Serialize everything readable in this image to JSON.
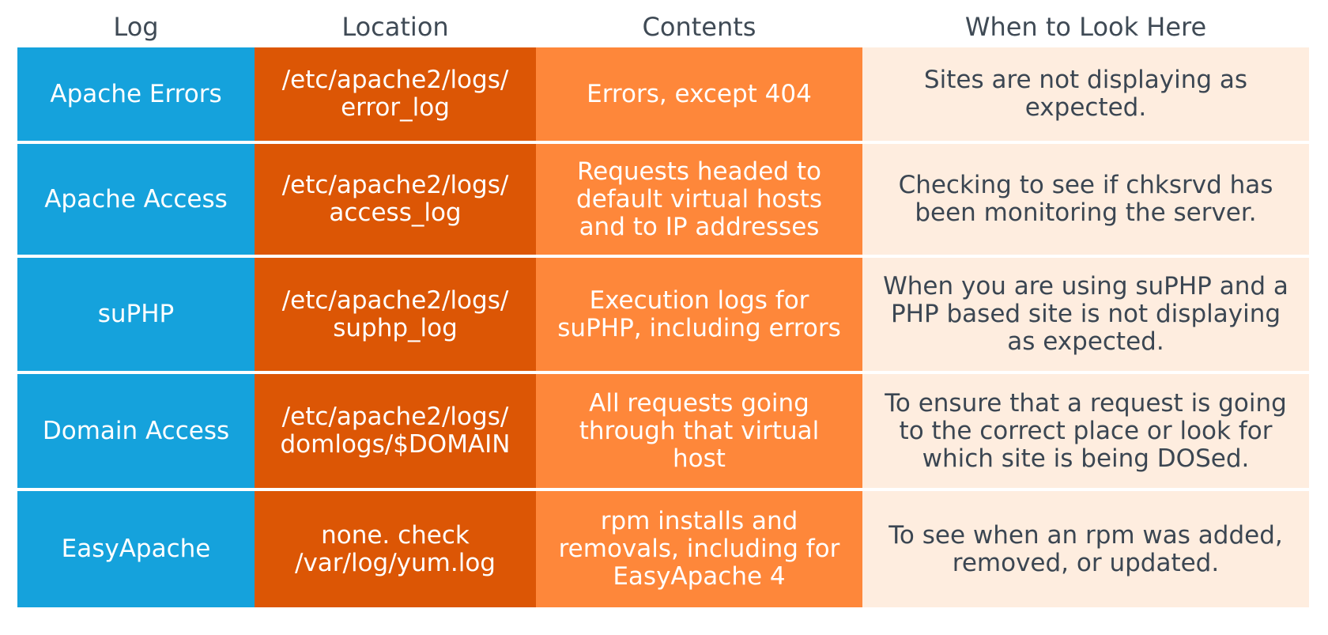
{
  "headers": [
    "Log",
    "Location",
    "Contents",
    "When to Look Here"
  ],
  "rows": [
    {
      "log": "Apache Errors",
      "location": "/etc/apache2/logs/\nerror_log",
      "contents": "Errors, except 404",
      "when": "Sites are not displaying as\nexpected."
    },
    {
      "log": "Apache Access",
      "location": "/etc/apache2/logs/\naccess_log",
      "contents": "Requests headed to\ndefault virtual hosts\nand to IP addresses",
      "when": "Checking to see if chksrvd has\nbeen monitoring the server."
    },
    {
      "log": "suPHP",
      "location": "/etc/apache2/logs/\nsuphp_log",
      "contents": "Execution logs for\nsuPHP, including errors",
      "when": "When you are using suPHP and a\nPHP based site is not displaying\nas expected."
    },
    {
      "log": "Domain Access",
      "location": "/etc/apache2/logs/\ndomlogs/$DOMAIN",
      "contents": "All requests going\nthrough that virtual\nhost",
      "when": "To ensure that a request is going\nto the correct place or look for\nwhich site is being DOSed."
    },
    {
      "log": "EasyApache",
      "location": "none.  check\n/var/log/yum.log",
      "contents": "rpm installs and\nremovals, including for\nEasyApache 4",
      "when": "To see when an rpm was added,\nremoved, or updated."
    }
  ],
  "colors": {
    "log_column": "#15a2dc",
    "location_column": "#dc5605",
    "contents_column": "#fe873a",
    "when_column": "#feeddf",
    "header_text": "#3f4a55",
    "when_text": "#3b4652"
  }
}
